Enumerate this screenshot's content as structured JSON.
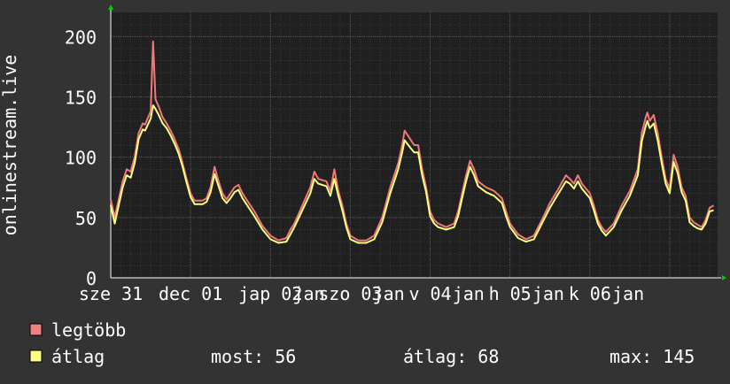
{
  "colors": {
    "background": "#333333",
    "plot_background": "#202020",
    "grid_minor": "#3a3a3a",
    "grid_major": "#5a5050",
    "max_series": "#f07878",
    "avg_series": "#ffff80",
    "text": "#ffffff",
    "arrow": "#00cc00"
  },
  "legend": {
    "items": [
      {
        "label": "legtöbb",
        "color": "#f08080"
      },
      {
        "label": "átlag",
        "color": "#ffff80"
      }
    ]
  },
  "stats": {
    "now": "most: 56",
    "avg": "átlag: 68",
    "max": "max: 145"
  },
  "chart_data": {
    "type": "line",
    "ylabel": "onlinestream.live",
    "ylim": [
      0,
      220
    ],
    "yticks": [
      "0",
      "50",
      "100",
      "150",
      "200"
    ],
    "ytick_values": [
      0,
      50,
      100,
      150,
      200
    ],
    "xlim": [
      0,
      7.6
    ],
    "x_tick_labels": [
      {
        "label": "sze 31",
        "x": 0
      },
      {
        "label": "dec 01",
        "x": 1
      },
      {
        "label": "jap 02",
        "x": 2
      },
      {
        "label": "jan",
        "x": 2.48
      },
      {
        "label": "szo 03",
        "x": 3
      },
      {
        "label": "jan",
        "x": 3.48
      },
      {
        "label": "v 04",
        "x": 4
      },
      {
        "label": "jan",
        "x": 4.48
      },
      {
        "label": "h 05",
        "x": 5
      },
      {
        "label": "jan",
        "x": 5.48
      },
      {
        "label": "k 06",
        "x": 6
      },
      {
        "label": "jan",
        "x": 6.48
      }
    ],
    "grid": true,
    "series": [
      {
        "name": "legtöbb",
        "color": "#f07878",
        "points": [
          [
            0.0,
            65
          ],
          [
            0.05,
            50
          ],
          [
            0.1,
            65
          ],
          [
            0.15,
            80
          ],
          [
            0.2,
            90
          ],
          [
            0.25,
            88
          ],
          [
            0.3,
            100
          ],
          [
            0.35,
            120
          ],
          [
            0.4,
            128
          ],
          [
            0.43,
            127
          ],
          [
            0.5,
            138
          ],
          [
            0.53,
            196
          ],
          [
            0.56,
            148
          ],
          [
            0.6,
            142
          ],
          [
            0.65,
            133
          ],
          [
            0.7,
            128
          ],
          [
            0.75,
            122
          ],
          [
            0.8,
            115
          ],
          [
            0.85,
            107
          ],
          [
            0.9,
            95
          ],
          [
            0.95,
            82
          ],
          [
            1.0,
            70
          ],
          [
            1.05,
            64
          ],
          [
            1.15,
            64
          ],
          [
            1.2,
            66
          ],
          [
            1.25,
            75
          ],
          [
            1.3,
            92
          ],
          [
            1.35,
            80
          ],
          [
            1.4,
            70
          ],
          [
            1.45,
            65
          ],
          [
            1.5,
            70
          ],
          [
            1.55,
            75
          ],
          [
            1.6,
            77
          ],
          [
            1.65,
            70
          ],
          [
            1.7,
            65
          ],
          [
            1.8,
            55
          ],
          [
            1.9,
            43
          ],
          [
            2.0,
            35
          ],
          [
            2.1,
            31
          ],
          [
            2.2,
            33
          ],
          [
            2.25,
            40
          ],
          [
            2.3,
            45
          ],
          [
            2.4,
            60
          ],
          [
            2.5,
            75
          ],
          [
            2.55,
            88
          ],
          [
            2.6,
            82
          ],
          [
            2.7,
            80
          ],
          [
            2.75,
            72
          ],
          [
            2.8,
            90
          ],
          [
            2.85,
            72
          ],
          [
            2.9,
            60
          ],
          [
            2.95,
            45
          ],
          [
            3.0,
            35
          ],
          [
            3.1,
            31
          ],
          [
            3.2,
            31
          ],
          [
            3.3,
            35
          ],
          [
            3.4,
            50
          ],
          [
            3.5,
            75
          ],
          [
            3.6,
            95
          ],
          [
            3.65,
            110
          ],
          [
            3.68,
            122
          ],
          [
            3.75,
            115
          ],
          [
            3.8,
            110
          ],
          [
            3.85,
            110
          ],
          [
            3.9,
            90
          ],
          [
            3.95,
            75
          ],
          [
            4.0,
            55
          ],
          [
            4.05,
            48
          ],
          [
            4.1,
            45
          ],
          [
            4.2,
            42
          ],
          [
            4.3,
            45
          ],
          [
            4.35,
            55
          ],
          [
            4.4,
            70
          ],
          [
            4.45,
            85
          ],
          [
            4.5,
            97
          ],
          [
            4.55,
            90
          ],
          [
            4.6,
            80
          ],
          [
            4.7,
            75
          ],
          [
            4.8,
            72
          ],
          [
            4.9,
            66
          ],
          [
            4.95,
            55
          ],
          [
            5.0,
            45
          ],
          [
            5.1,
            36
          ],
          [
            5.2,
            32
          ],
          [
            5.3,
            35
          ],
          [
            5.4,
            48
          ],
          [
            5.5,
            62
          ],
          [
            5.6,
            73
          ],
          [
            5.7,
            85
          ],
          [
            5.75,
            82
          ],
          [
            5.8,
            78
          ],
          [
            5.85,
            85
          ],
          [
            5.9,
            78
          ],
          [
            6.0,
            70
          ],
          [
            6.05,
            60
          ],
          [
            6.1,
            48
          ],
          [
            6.15,
            42
          ],
          [
            6.2,
            38
          ],
          [
            6.3,
            45
          ],
          [
            6.4,
            60
          ],
          [
            6.5,
            72
          ],
          [
            6.6,
            90
          ],
          [
            6.65,
            120
          ],
          [
            6.7,
            133
          ],
          [
            6.72,
            137
          ],
          [
            6.75,
            130
          ],
          [
            6.8,
            135
          ],
          [
            6.85,
            120
          ],
          [
            6.9,
            100
          ],
          [
            6.95,
            82
          ],
          [
            7.0,
            74
          ],
          [
            7.05,
            102
          ],
          [
            7.1,
            92
          ],
          [
            7.15,
            75
          ],
          [
            7.2,
            68
          ],
          [
            7.25,
            50
          ],
          [
            7.3,
            46
          ],
          [
            7.35,
            44
          ],
          [
            7.4,
            42
          ],
          [
            7.45,
            48
          ],
          [
            7.5,
            58
          ],
          [
            7.55,
            60
          ]
        ]
      },
      {
        "name": "átlag",
        "color": "#ffff80",
        "points": [
          [
            0.0,
            60
          ],
          [
            0.05,
            45
          ],
          [
            0.1,
            60
          ],
          [
            0.15,
            75
          ],
          [
            0.2,
            85
          ],
          [
            0.25,
            83
          ],
          [
            0.3,
            95
          ],
          [
            0.35,
            115
          ],
          [
            0.4,
            123
          ],
          [
            0.43,
            122
          ],
          [
            0.5,
            132
          ],
          [
            0.53,
            143
          ],
          [
            0.56,
            140
          ],
          [
            0.6,
            135
          ],
          [
            0.65,
            128
          ],
          [
            0.7,
            124
          ],
          [
            0.75,
            118
          ],
          [
            0.8,
            111
          ],
          [
            0.85,
            103
          ],
          [
            0.9,
            92
          ],
          [
            0.95,
            79
          ],
          [
            1.0,
            67
          ],
          [
            1.05,
            61
          ],
          [
            1.15,
            61
          ],
          [
            1.2,
            63
          ],
          [
            1.25,
            71
          ],
          [
            1.3,
            86
          ],
          [
            1.35,
            76
          ],
          [
            1.4,
            66
          ],
          [
            1.45,
            62
          ],
          [
            1.5,
            66
          ],
          [
            1.55,
            71
          ],
          [
            1.6,
            73
          ],
          [
            1.65,
            66
          ],
          [
            1.7,
            61
          ],
          [
            1.8,
            51
          ],
          [
            1.9,
            40
          ],
          [
            2.0,
            32
          ],
          [
            2.1,
            29
          ],
          [
            2.2,
            30
          ],
          [
            2.25,
            36
          ],
          [
            2.3,
            42
          ],
          [
            2.4,
            56
          ],
          [
            2.5,
            70
          ],
          [
            2.55,
            82
          ],
          [
            2.6,
            78
          ],
          [
            2.7,
            76
          ],
          [
            2.75,
            68
          ],
          [
            2.8,
            82
          ],
          [
            2.85,
            68
          ],
          [
            2.9,
            56
          ],
          [
            2.95,
            42
          ],
          [
            3.0,
            32
          ],
          [
            3.1,
            29
          ],
          [
            3.2,
            29
          ],
          [
            3.3,
            32
          ],
          [
            3.4,
            46
          ],
          [
            3.5,
            70
          ],
          [
            3.6,
            90
          ],
          [
            3.65,
            104
          ],
          [
            3.68,
            114
          ],
          [
            3.75,
            108
          ],
          [
            3.8,
            104
          ],
          [
            3.85,
            104
          ],
          [
            3.9,
            85
          ],
          [
            3.95,
            71
          ],
          [
            4.0,
            51
          ],
          [
            4.05,
            45
          ],
          [
            4.1,
            42
          ],
          [
            4.2,
            40
          ],
          [
            4.3,
            42
          ],
          [
            4.35,
            51
          ],
          [
            4.4,
            66
          ],
          [
            4.45,
            80
          ],
          [
            4.5,
            92
          ],
          [
            4.55,
            85
          ],
          [
            4.6,
            76
          ],
          [
            4.7,
            71
          ],
          [
            4.8,
            68
          ],
          [
            4.9,
            62
          ],
          [
            4.95,
            51
          ],
          [
            5.0,
            42
          ],
          [
            5.1,
            33
          ],
          [
            5.2,
            30
          ],
          [
            5.3,
            32
          ],
          [
            5.4,
            45
          ],
          [
            5.5,
            58
          ],
          [
            5.6,
            69
          ],
          [
            5.7,
            80
          ],
          [
            5.75,
            78
          ],
          [
            5.8,
            74
          ],
          [
            5.85,
            80
          ],
          [
            5.9,
            74
          ],
          [
            6.0,
            66
          ],
          [
            6.05,
            56
          ],
          [
            6.1,
            45
          ],
          [
            6.15,
            39
          ],
          [
            6.2,
            35
          ],
          [
            6.3,
            42
          ],
          [
            6.4,
            56
          ],
          [
            6.5,
            68
          ],
          [
            6.6,
            85
          ],
          [
            6.65,
            113
          ],
          [
            6.7,
            126
          ],
          [
            6.72,
            130
          ],
          [
            6.75,
            124
          ],
          [
            6.8,
            128
          ],
          [
            6.85,
            114
          ],
          [
            6.9,
            95
          ],
          [
            6.95,
            78
          ],
          [
            7.0,
            70
          ],
          [
            7.05,
            96
          ],
          [
            7.1,
            87
          ],
          [
            7.15,
            71
          ],
          [
            7.2,
            64
          ],
          [
            7.25,
            46
          ],
          [
            7.3,
            43
          ],
          [
            7.35,
            41
          ],
          [
            7.4,
            40
          ],
          [
            7.45,
            45
          ],
          [
            7.5,
            55
          ],
          [
            7.55,
            56
          ]
        ]
      }
    ]
  }
}
